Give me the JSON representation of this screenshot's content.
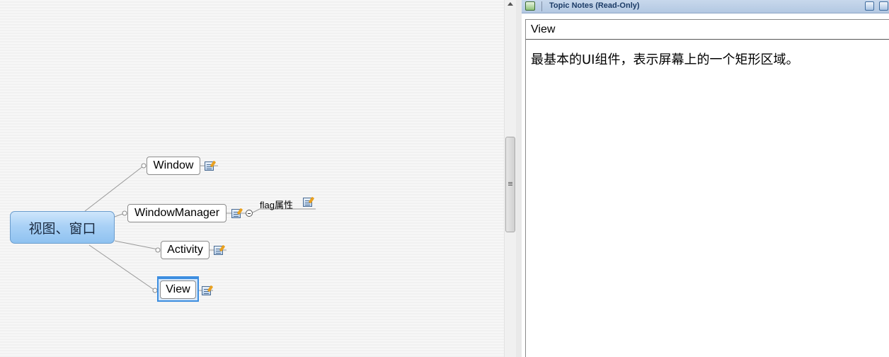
{
  "mindmap": {
    "central_topic": "视图、窗口",
    "topics": [
      {
        "label": "Window",
        "has_note": true
      },
      {
        "label": "WindowManager",
        "has_note": true,
        "subtopics": [
          {
            "label": "flag属性",
            "has_note": true
          }
        ]
      },
      {
        "label": "Activity",
        "has_note": true
      },
      {
        "label": "View",
        "has_note": true,
        "selected": true
      }
    ]
  },
  "notes_panel": {
    "title": "Topic Notes (Read-Only)",
    "topic_name": "View",
    "content": "最基本的UI组件，表示屏幕上的一个矩形区域。"
  },
  "colors": {
    "central_fill": "#a9d1f6",
    "selection": "#3d8ee0",
    "header": "#b3c8e2"
  }
}
